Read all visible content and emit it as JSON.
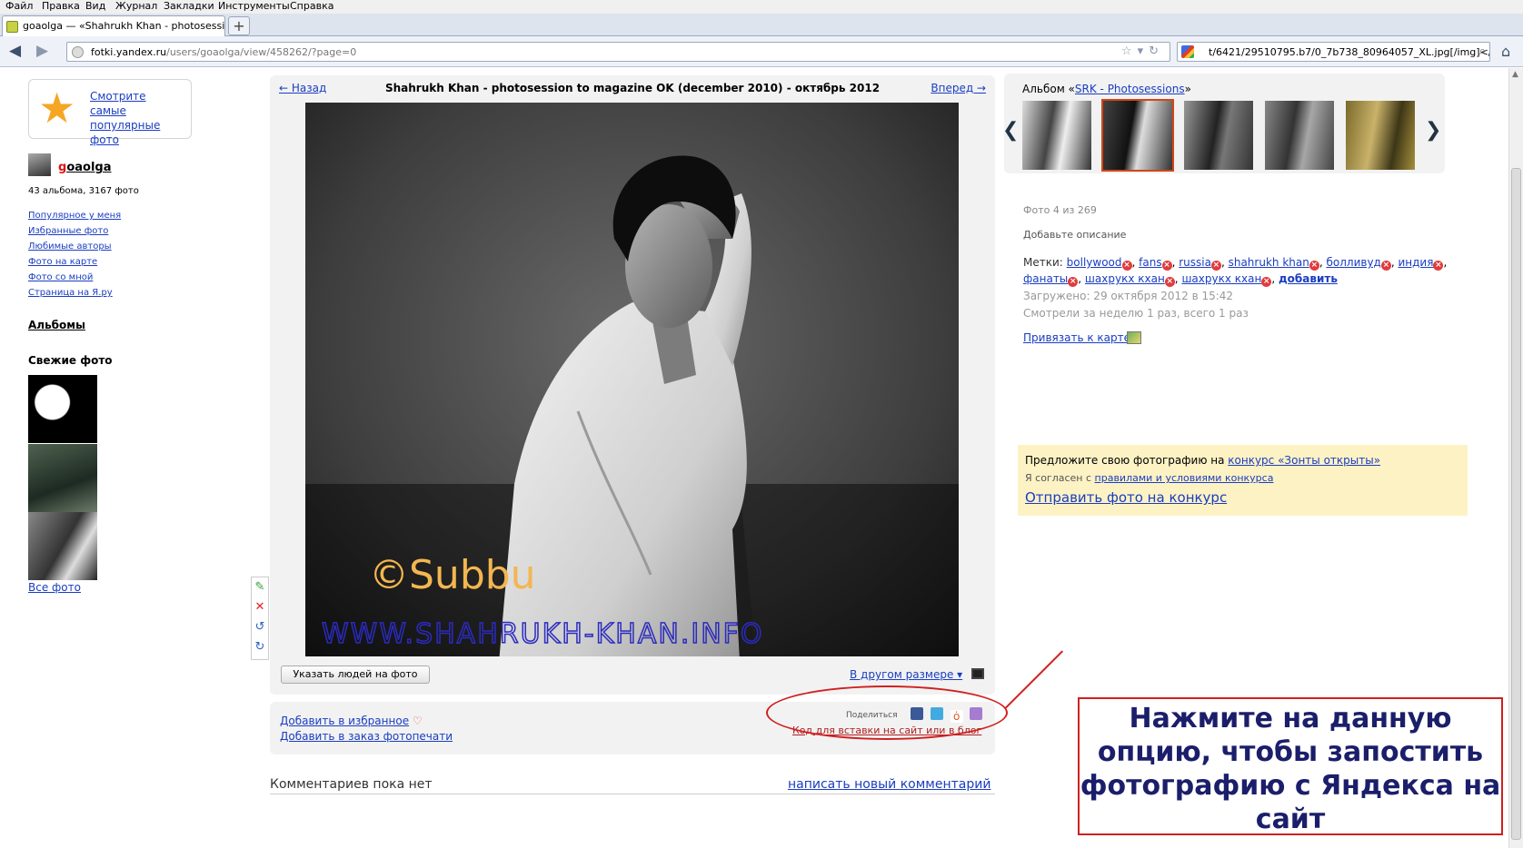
{
  "menubar": {
    "file": "Файл",
    "edit": "Правка",
    "view": "Вид",
    "history": "Журнал",
    "bookmarks": "Закладки",
    "tools": "Инструменты",
    "help": "Справка"
  },
  "tab": {
    "title": "goaolga — «Shahrukh Khan - photosession t...",
    "new_tab": "+"
  },
  "nav": {
    "back": "◀",
    "forward": "▶",
    "url_domain": "fotki.yandex.ru",
    "url_rest": "/users/goaolga/view/458262/?page=0",
    "url_prefix": "",
    "search_text": "t/6421/29510795.b7/0_7b738_80964057_XL.jpg[/img]</p>"
  },
  "left": {
    "popular_text": "Смотрите самые популярные фото",
    "username_first": "g",
    "username_rest": "oaolga",
    "stats": "43 альбома, 3167 фото",
    "links": [
      "Популярное у меня",
      "Избранные фото",
      "Любимые авторы",
      "Фото на карте",
      "Фото со мной",
      "Страница на Я.ру"
    ],
    "albums": "Альбомы",
    "fresh": "Свежие фото",
    "all_photos": "Все фото"
  },
  "center": {
    "prev": "← Назад",
    "title": "Shahrukh Khan - photosession to magazine OK (december 2010) - октябрь 2012",
    "next": "Вперед →",
    "watermark1": "©Subbu",
    "watermark2": "WWW.SHAHRUKH-KHAN.INFO",
    "mark_people": "Указать людей на фото",
    "other_size": "В другом размере ▾",
    "add_fav": "Добавить в избранное",
    "add_order": "Добавить в заказ фотопечати",
    "share": "Поделиться",
    "embed": "Код для вставки на сайт или в блог",
    "no_comments": "Комментариев пока нет",
    "write_comment": "написать новый комментарий"
  },
  "right": {
    "album_prefix": "Альбом «",
    "album_name": "SRK - Photosessions",
    "album_suffix": "»",
    "photo_count": "Фото 4 из 269",
    "add_description": "Добавьте описание",
    "tags_label": "Метки:",
    "tags": [
      "bollywood",
      "fans",
      "russia",
      "shahrukh khan",
      "болливуд",
      "индия",
      "фанаты",
      "шахрукх кхан",
      "шахрукх кхан"
    ],
    "tags_add": "добавить",
    "uploaded": "Загружено: 29 октября 2012 в 15:42",
    "views": "Смотрели за неделю 1 раз, всего 1 раз",
    "map_link": "Привязать к карте",
    "contest_text": "Предложите свою фотографию на ",
    "contest_link": "конкурс «Зонты открыты»",
    "agree_text": "Я согласен с ",
    "agree_link": "правилами и условиями конкурса",
    "send": "Отправить фото на конкурс"
  },
  "annotation": {
    "text": "Нажмите на данную опцию, чтобы запостить фотографию с Яндекса на сайт"
  },
  "colors": {
    "link": "#1a3dc1",
    "panel": "#f2f2f2",
    "highlight": "#d24616",
    "contest_bg": "#fdf2c4",
    "annotation": "#d02020"
  }
}
